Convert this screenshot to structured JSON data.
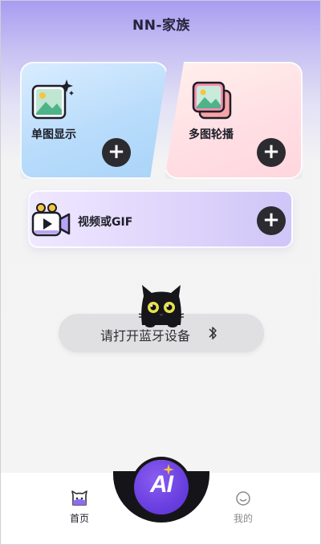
{
  "header": {
    "title": "NN-家族"
  },
  "cards": {
    "single": {
      "label": "单图显示",
      "icon": "image-sparkle-icon",
      "action": "+"
    },
    "multi": {
      "label": "多图轮播",
      "icon": "image-stack-icon",
      "action": "+"
    },
    "video": {
      "label": "视频或GIF",
      "icon": "video-camera-icon",
      "action": "+"
    }
  },
  "bluetooth": {
    "prompt": "请打开蓝牙设备",
    "icon": "bluetooth-icon"
  },
  "tabbar": {
    "home_label": "首页",
    "ai_label": "AI",
    "mine_label": "我的"
  },
  "colors": {
    "header_gradient_top": "#a99cf2",
    "accent_purple": "#6a3fe0",
    "button_dark": "#2b2b30",
    "star_yellow": "#f5c542"
  }
}
